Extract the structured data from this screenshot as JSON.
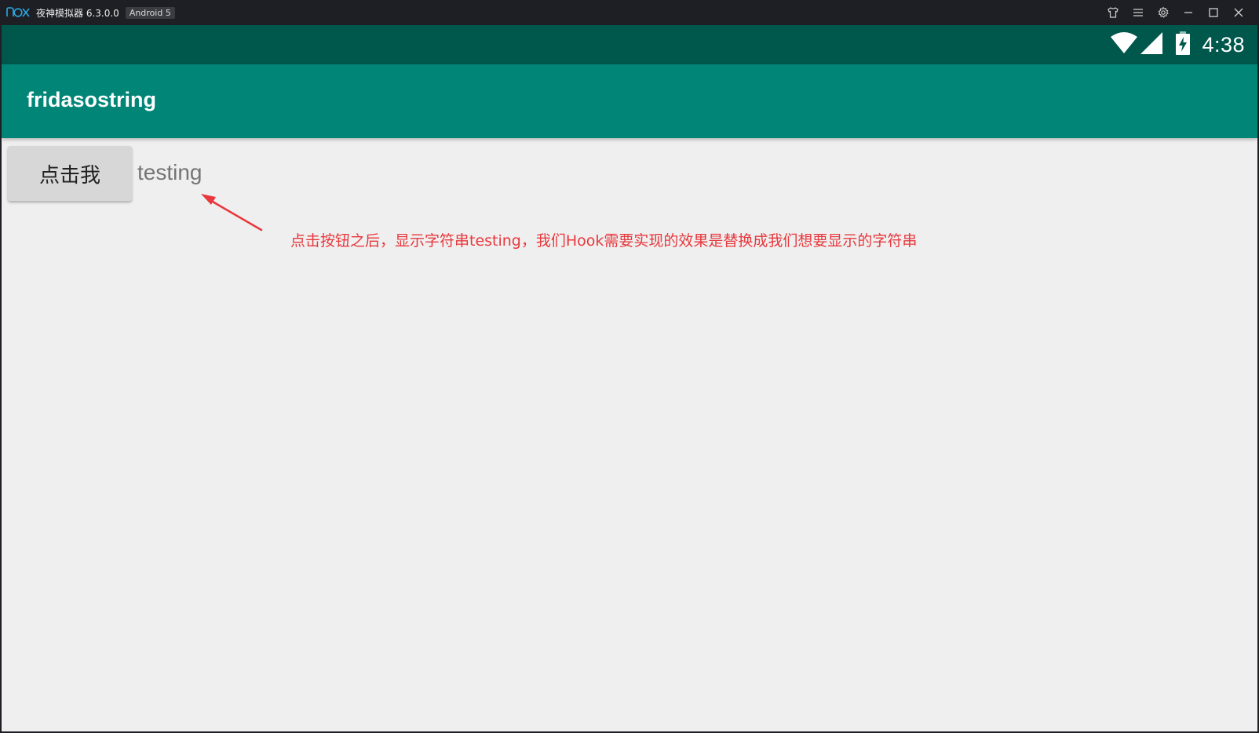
{
  "titlebar": {
    "logo_text": "nox",
    "title": "夜神模拟器 6.3.0.0",
    "android_badge": "Android 5",
    "controls": [
      "shirt-icon",
      "menu-icon",
      "gear-icon",
      "minimize-icon",
      "maximize-icon",
      "close-icon"
    ]
  },
  "statusbar": {
    "time": "4:38",
    "icons": [
      "wifi-icon",
      "signal-icon",
      "battery-charging-icon"
    ]
  },
  "appbar": {
    "title": "fridasostring"
  },
  "content": {
    "button_label": "点击我",
    "result_text": "testing"
  },
  "annotation": {
    "text": "点击按钮之后，显示字符串testing，我们Hook需要实现的效果是替换成我们想要显示的字符串"
  },
  "colors": {
    "statusbar": "#00574b",
    "appbar": "#008577",
    "background": "#efefef",
    "annotation": "#e8383d"
  }
}
